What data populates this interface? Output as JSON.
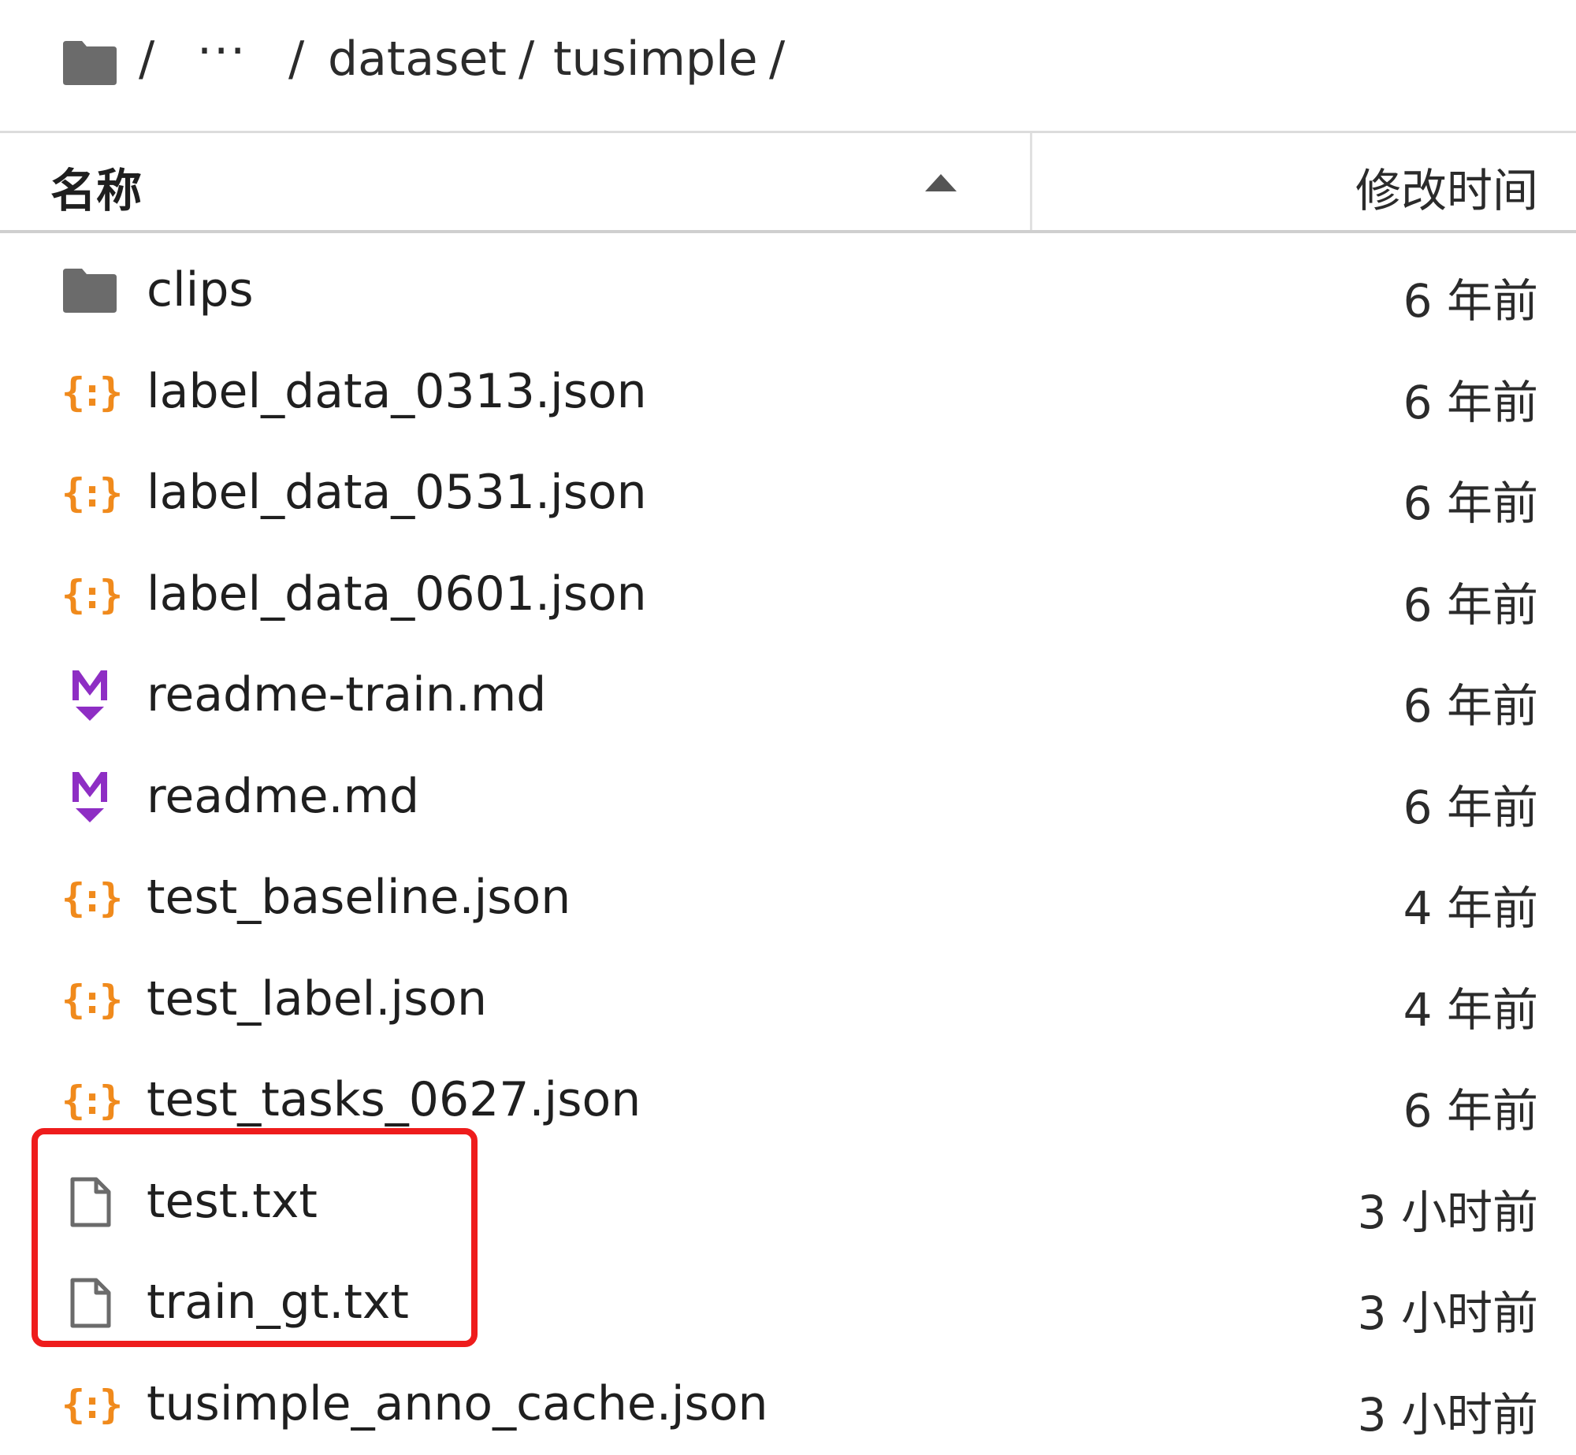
{
  "breadcrumb": {
    "root_icon": "folder-icon",
    "separator": "/",
    "ellipsis": "···",
    "items": [
      {
        "label": "dataset"
      },
      {
        "label": "tusimple"
      }
    ]
  },
  "table": {
    "columns": {
      "name": "名称",
      "modified": "修改时间"
    },
    "sort": {
      "column": "name",
      "direction": "ascending",
      "icon": "sort-ascending-icon"
    },
    "rows": [
      {
        "type": "folder",
        "icon": "folder-icon",
        "name": "clips",
        "modified": "6 年前"
      },
      {
        "type": "json",
        "icon": "json-file-icon",
        "name": "label_data_0313.json",
        "modified": "6 年前"
      },
      {
        "type": "json",
        "icon": "json-file-icon",
        "name": "label_data_0531.json",
        "modified": "6 年前"
      },
      {
        "type": "json",
        "icon": "json-file-icon",
        "name": "label_data_0601.json",
        "modified": "6 年前"
      },
      {
        "type": "markdown",
        "icon": "markdown-file-icon",
        "name": "readme-train.md",
        "modified": "6 年前"
      },
      {
        "type": "markdown",
        "icon": "markdown-file-icon",
        "name": "readme.md",
        "modified": "6 年前"
      },
      {
        "type": "json",
        "icon": "json-file-icon",
        "name": "test_baseline.json",
        "modified": "4 年前"
      },
      {
        "type": "json",
        "icon": "json-file-icon",
        "name": "test_label.json",
        "modified": "4 年前"
      },
      {
        "type": "json",
        "icon": "json-file-icon",
        "name": "test_tasks_0627.json",
        "modified": "6 年前"
      },
      {
        "type": "text",
        "icon": "text-file-icon",
        "name": "test.txt",
        "modified": "3 小时前"
      },
      {
        "type": "text",
        "icon": "text-file-icon",
        "name": "train_gt.txt",
        "modified": "3 小时前"
      },
      {
        "type": "json",
        "icon": "json-file-icon",
        "name": "tusimple_anno_cache.json",
        "modified": "3 小时前"
      }
    ]
  },
  "colors": {
    "folder": "#6b6b6b",
    "json": "#f08a1c",
    "markdown": "#8e2ec4",
    "text_file": "#6b6b6b",
    "highlight": "#ee1c1c"
  }
}
